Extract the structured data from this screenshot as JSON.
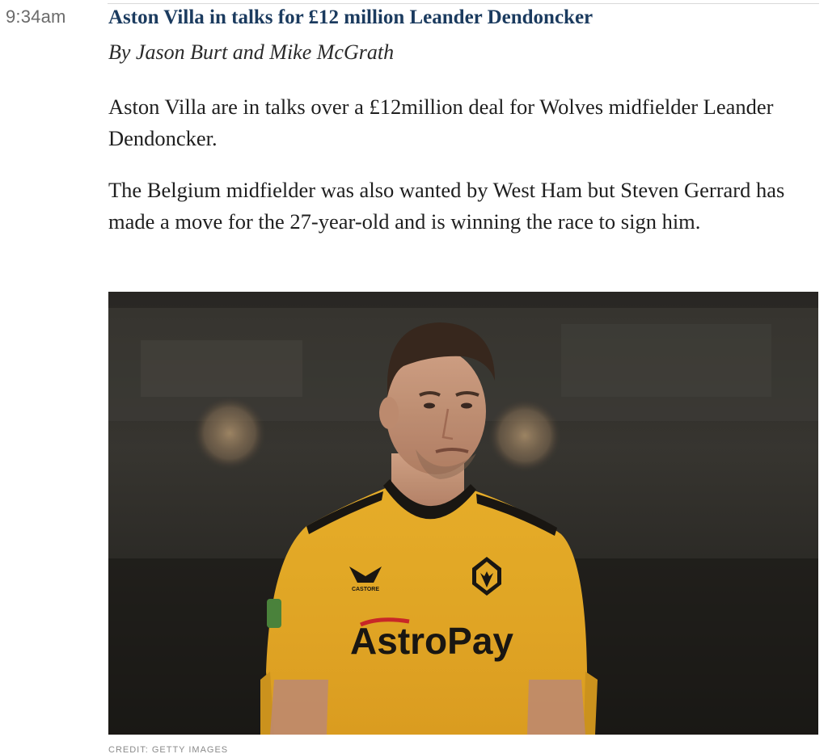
{
  "entry": {
    "time": "9:34am",
    "headline": "Aston Villa in talks for £12 million Leander Dendoncker",
    "byline": "By Jason Burt and Mike McGrath",
    "paragraphs": [
      "Aston Villa are in talks over a £12million deal for Wolves midfielder Leander Dendoncker.",
      "The Belgium midfielder was also wanted by West Ham but Steven Gerrard has made a move for the 27-year-old and is winning the race to sign him."
    ],
    "image": {
      "shirt_sponsor": "AstroPay",
      "kit_maker": "CASTORE",
      "credit": "CREDIT: GETTY IMAGES"
    }
  },
  "colors": {
    "headline": "#1b3b5f",
    "timestamp": "#6b6b6b",
    "shirt": "#f0b22a"
  }
}
